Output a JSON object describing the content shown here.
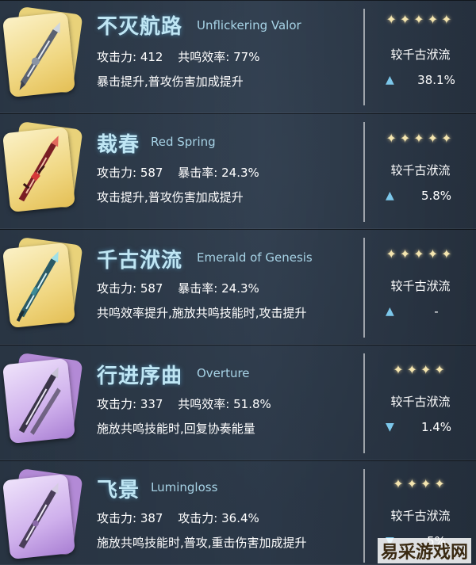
{
  "compare_label": "较千古洑流",
  "stat_atk_label": "攻击力:",
  "weapons": [
    {
      "name_cn": "不灭航路",
      "name_en": "Unflickering Valor",
      "atk": "412",
      "sub_label": "共鸣效率:",
      "sub_value": "77%",
      "effect": "暴击提升,普攻伤害加成提升",
      "stars": "✦✦✦✦✦",
      "trend": "up",
      "trend_icon": "▲",
      "pct": "38.1%",
      "rarity_color": "gold"
    },
    {
      "name_cn": "裁春",
      "name_en": "Red Spring",
      "atk": "587",
      "sub_label": "暴击率:",
      "sub_value": "24.3%",
      "effect": "攻击提升,普攻伤害加成提升",
      "stars": "✦✦✦✦✦",
      "trend": "up",
      "trend_icon": "▲",
      "pct": "5.8%",
      "rarity_color": "gold"
    },
    {
      "name_cn": "千古洑流",
      "name_en": "Emerald of Genesis",
      "atk": "587",
      "sub_label": "暴击率:",
      "sub_value": "24.3%",
      "effect": "共鸣效率提升,施放共鸣技能时,攻击提升",
      "stars": "✦✦✦✦✦",
      "trend": "up",
      "trend_icon": "▲",
      "pct": "-",
      "rarity_color": "gold"
    },
    {
      "name_cn": "行进序曲",
      "name_en": "Overture",
      "atk": "337",
      "sub_label": "共鸣效率:",
      "sub_value": "51.8%",
      "effect": "施放共鸣技能时,回复协奏能量",
      "stars": "✦✦✦✦",
      "trend": "down",
      "trend_icon": "▼",
      "pct": "1.4%",
      "rarity_color": "purple"
    },
    {
      "name_cn": "飞景",
      "name_en": "Lumingloss",
      "atk": "387",
      "sub_label": "攻击力:",
      "sub_value": "36.4%",
      "effect": "施放共鸣技能时,普攻,重击伤害加成提升",
      "stars": "✦✦✦✦",
      "trend": "down",
      "trend_icon": "▼",
      "pct": "5%",
      "rarity_color": "purple"
    }
  ],
  "watermark": "易采游戏网",
  "icons": {
    "card": "sword-weapon-icon",
    "star": "star-icon",
    "up": "triangle-up-icon",
    "down": "triangle-down-icon"
  },
  "colors": {
    "name": "#bfe6f4",
    "accent": "#7cc7ea",
    "gold_card": "#f0d782",
    "purple_card": "#cfb0ec"
  }
}
